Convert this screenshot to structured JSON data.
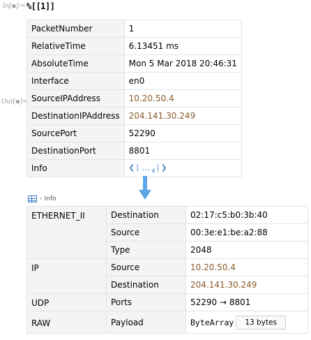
{
  "cell_labels": {
    "in": "In[▪]:=",
    "out": "Out[▪]="
  },
  "input": {
    "code": "%[[1]]"
  },
  "association": {
    "rows": [
      {
        "key": "PacketNumber",
        "value": "1",
        "color": "plain"
      },
      {
        "key": "RelativeTime",
        "value": "6.13451 ms",
        "color": "plain"
      },
      {
        "key": "AbsoluteTime",
        "value": "Mon 5 Mar 2018 20:46:31",
        "color": "plain"
      },
      {
        "key": "Interface",
        "value": "en0",
        "color": "plain"
      },
      {
        "key": "SourceIPAddress",
        "value": "10.20.50.4",
        "color": "brown"
      },
      {
        "key": "DestinationIPAddress",
        "value": "204.141.30.249",
        "color": "brown"
      },
      {
        "key": "SourcePort",
        "value": "52290",
        "color": "plain"
      },
      {
        "key": "DestinationPort",
        "value": "8801",
        "color": "plain"
      },
      {
        "key": "Info",
        "value": "",
        "color": "plain"
      }
    ],
    "info_elided": {
      "dots": "…",
      "count": "4"
    }
  },
  "breadcrumb": {
    "separator": "›",
    "label": "Info"
  },
  "dataset": {
    "groups": [
      {
        "name": "ETHERNET_II",
        "rows": [
          {
            "field": "Destination",
            "value": "02:17:c5:b0:3b:40",
            "color": "plain"
          },
          {
            "field": "Source",
            "value": "00:3e:e1:be:a2:88",
            "color": "plain"
          },
          {
            "field": "Type",
            "value": "2048",
            "color": "plain"
          }
        ]
      },
      {
        "name": "IP",
        "rows": [
          {
            "field": "Source",
            "value": "10.20.50.4",
            "color": "brown"
          },
          {
            "field": "Destination",
            "value": "204.141.30.249",
            "color": "brown"
          }
        ]
      },
      {
        "name": "UDP",
        "rows": [
          {
            "field": "Ports",
            "value": "52290 → 8801",
            "color": "plain"
          }
        ]
      },
      {
        "name": "RAW",
        "rows": [
          {
            "field": "Payload",
            "value": "ByteArray",
            "box": "13 bytes",
            "color": "plain"
          }
        ]
      }
    ]
  },
  "colors": {
    "brown": "#8b5a2b",
    "link_blue": "#3b7fc4",
    "arrow_blue": "#5aa6e6",
    "key_bg": "#f4f4f4"
  },
  "icons": {
    "arrow": "down-arrow-icon",
    "breadcrumb": "table-icon"
  }
}
